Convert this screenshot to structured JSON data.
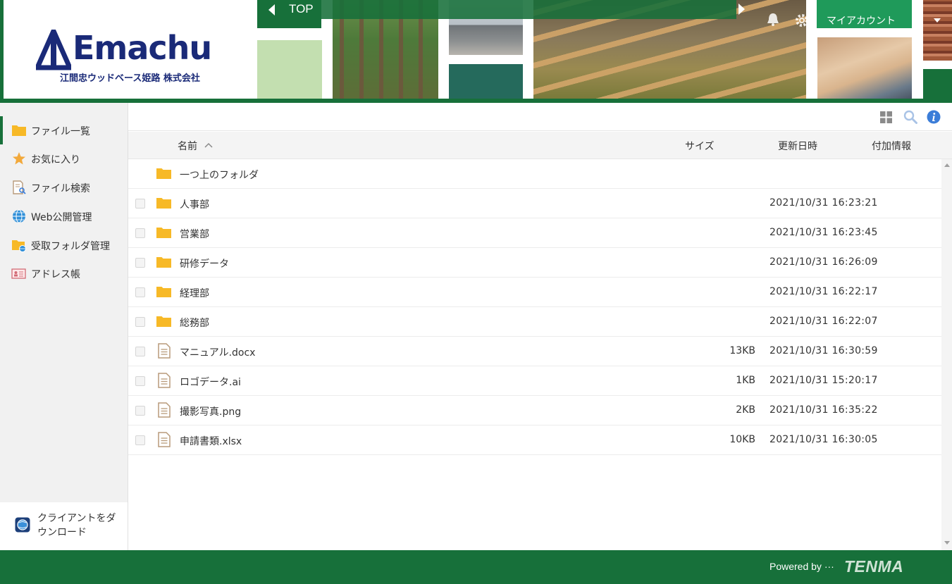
{
  "header": {
    "logo_text": "Emachu",
    "company_name": "江間忠ウッドベース姫路 株式会社",
    "top_button": "TOP",
    "my_account": "マイアカウント"
  },
  "sidebar": {
    "items": [
      {
        "label": "ファイル一覧",
        "icon": "folder-icon",
        "active": true
      },
      {
        "label": "お気に入り",
        "icon": "star-icon"
      },
      {
        "label": "ファイル検索",
        "icon": "file-search-icon"
      },
      {
        "label": "Web公開管理",
        "icon": "globe-icon"
      },
      {
        "label": "受取フォルダ管理",
        "icon": "folder-globe-icon"
      },
      {
        "label": "アドレス帳",
        "icon": "address-book-icon"
      }
    ],
    "client_download": "クライアントをダウンロード"
  },
  "table": {
    "headers": {
      "name": "名前",
      "size": "サイズ",
      "modified": "更新日時",
      "extra": "付加情報"
    },
    "parent_folder": "一つ上のフォルダ",
    "rows": [
      {
        "type": "folder",
        "name": "人事部",
        "size": "",
        "modified": "2021/10/31 16:23:21"
      },
      {
        "type": "folder",
        "name": "営業部",
        "size": "",
        "modified": "2021/10/31 16:23:45"
      },
      {
        "type": "folder",
        "name": "研修データ",
        "size": "",
        "modified": "2021/10/31 16:26:09"
      },
      {
        "type": "folder",
        "name": "経理部",
        "size": "",
        "modified": "2021/10/31 16:22:17"
      },
      {
        "type": "folder",
        "name": "総務部",
        "size": "",
        "modified": "2021/10/31 16:22:07"
      },
      {
        "type": "file",
        "name": "マニュアル.docx",
        "size": "13KB",
        "modified": "2021/10/31 16:30:59"
      },
      {
        "type": "file",
        "name": "ロゴデータ.ai",
        "size": "1KB",
        "modified": "2021/10/31 15:20:17"
      },
      {
        "type": "file",
        "name": "撮影写真.png",
        "size": "2KB",
        "modified": "2021/10/31 16:35:22"
      },
      {
        "type": "file",
        "name": "申請書類.xlsx",
        "size": "10KB",
        "modified": "2021/10/31 16:30:05"
      }
    ]
  },
  "footer": {
    "powered_by": "Powered by ···",
    "brand": "TENMA"
  },
  "colors": {
    "brand_green": "#17703a",
    "logo_navy": "#1a2a78",
    "folder_yellow": "#f7b927",
    "account_green": "#1f9a5a"
  }
}
